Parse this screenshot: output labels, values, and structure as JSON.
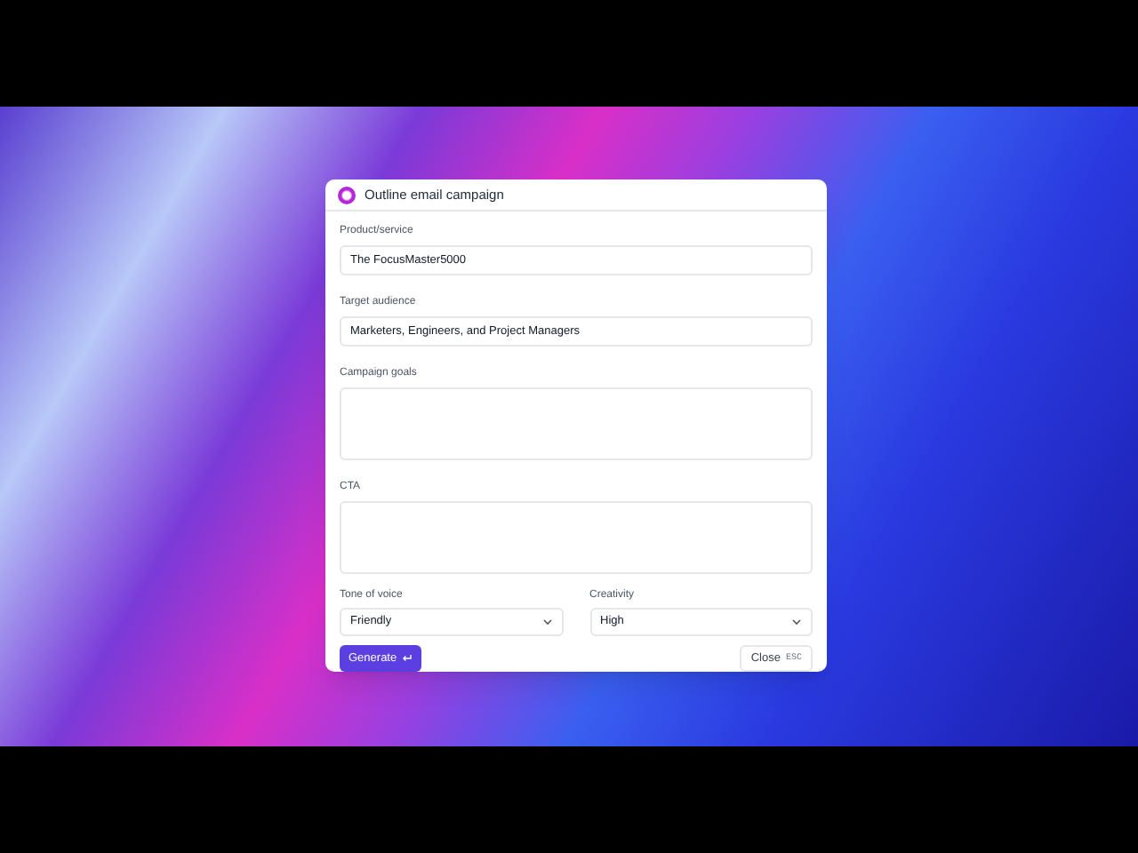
{
  "dialog": {
    "title": "Outline email campaign",
    "fields": [
      {
        "kind": "text",
        "label": "Product/service",
        "value": "The FocusMaster5000"
      },
      {
        "kind": "text",
        "label": "Target audience",
        "value": "Marketers, Engineers, and Project Managers"
      },
      {
        "kind": "textarea",
        "label": "Campaign goals"
      },
      {
        "kind": "textarea",
        "label": "CTA"
      }
    ],
    "selects": [
      {
        "label": "Tone of voice",
        "value": "Friendly"
      },
      {
        "label": "Creativity",
        "value": "High"
      }
    ],
    "generate_button": "Generate",
    "close_button": {
      "label": "Close",
      "shortcut": "ESC"
    }
  }
}
